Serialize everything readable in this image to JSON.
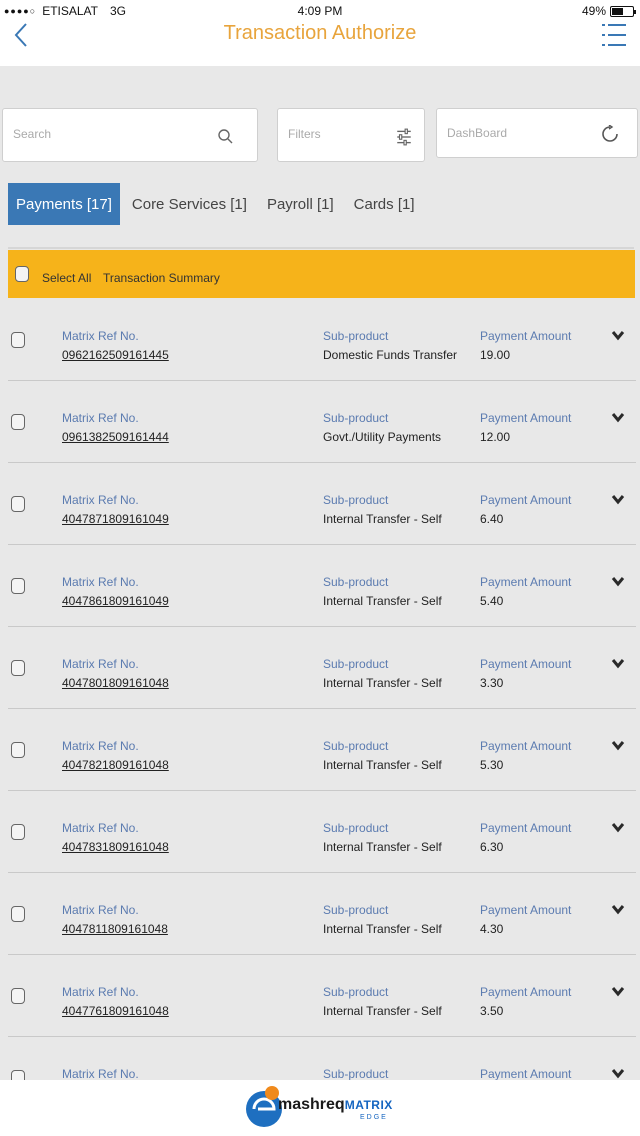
{
  "status": {
    "carrier": "ETISALAT",
    "network": "3G",
    "time": "4:09 PM",
    "battery": "49%"
  },
  "header": {
    "title": "Transaction Authorize"
  },
  "search": {
    "placeholder": "Search"
  },
  "filters": {
    "placeholder": "Filters"
  },
  "dashboard": {
    "placeholder": "DashBoard"
  },
  "tabs": [
    {
      "label": "Payments [17]"
    },
    {
      "label": "Core Services [1]"
    },
    {
      "label": "Payroll [1]"
    },
    {
      "label": "Cards [1]"
    }
  ],
  "select_bar": {
    "select_all": "Select All",
    "summary": "Transaction Summary"
  },
  "column_labels": {
    "ref": "Matrix Ref No.",
    "sub": "Sub-product",
    "amount": "Payment Amount"
  },
  "rows": [
    {
      "ref": "0962162509161445",
      "sub": "Domestic Funds Transfer",
      "amount": "19.00"
    },
    {
      "ref": "0961382509161444",
      "sub": "Govt./Utility Payments",
      "amount": "12.00"
    },
    {
      "ref": "4047871809161049",
      "sub": "Internal Transfer - Self",
      "amount": "6.40"
    },
    {
      "ref": "4047861809161049",
      "sub": "Internal Transfer - Self",
      "amount": "5.40"
    },
    {
      "ref": "4047801809161048",
      "sub": "Internal Transfer - Self",
      "amount": "3.30"
    },
    {
      "ref": "4047821809161048",
      "sub": "Internal Transfer - Self",
      "amount": "5.30"
    },
    {
      "ref": "4047831809161048",
      "sub": "Internal Transfer - Self",
      "amount": "6.30"
    },
    {
      "ref": "4047811809161048",
      "sub": "Internal Transfer - Self",
      "amount": "4.30"
    },
    {
      "ref": "4047761809161048",
      "sub": "Internal Transfer - Self",
      "amount": "3.50"
    },
    {
      "ref": "",
      "sub": "",
      "amount": ""
    }
  ],
  "footer": {
    "brand_main": "mashreq",
    "brand_accent": "MATRIX",
    "brand_sub": "EDGE"
  },
  "colors": {
    "accent": "#f6b31a",
    "tab_active": "#3a78b5",
    "title": "#e8a43c",
    "label": "#5b7bb0"
  },
  "icons": {
    "back": "chevron-left-icon",
    "menu": "menu-icon",
    "search": "search-icon",
    "filters": "sliders-icon",
    "dashboard": "refresh-icon",
    "expand": "chevron-down-icon"
  }
}
